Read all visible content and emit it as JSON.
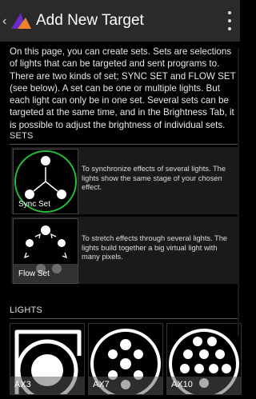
{
  "appbar": {
    "title": "Add New Target",
    "back_icon": "chevron-left-icon",
    "logo_icon": "app-logo-icon",
    "menu_icon": "overflow-menu-icon",
    "logo_colors": [
      "#6a2cc9",
      "#f0832a"
    ]
  },
  "intro": {
    "text": "On this page, you can create sets. Sets are selections of lights that can be targeted and sent programs to. There are two kinds of set; SYNC SET and FLOW SET (see below). A set can be one or multiple lights. But each light can only be in one set. Several sets can be targeted at the same time, and in the Brightness Tab, it is possible to adjust the brightness of individual sets."
  },
  "sets": {
    "heading": "SETS",
    "items": [
      {
        "label": "Sync Set",
        "description": "To synchronize effects of several lights. The lights show the same stage of your chosen effect.",
        "icon": "sync-set-icon",
        "selected": true,
        "ring_color": "#22c03a"
      },
      {
        "label": "Flow Set",
        "description": "To stretch effects through several lights. The lights build together a big virtual light with many pixels.",
        "icon": "flow-set-icon",
        "selected": false
      }
    ]
  },
  "lights": {
    "heading": "LIGHTS",
    "items": [
      {
        "label": "AX3",
        "icon": "ax3-light-icon"
      },
      {
        "label": "AX7",
        "icon": "ax7-light-icon"
      },
      {
        "label": "AX10",
        "icon": "ax10-light-icon"
      }
    ]
  }
}
